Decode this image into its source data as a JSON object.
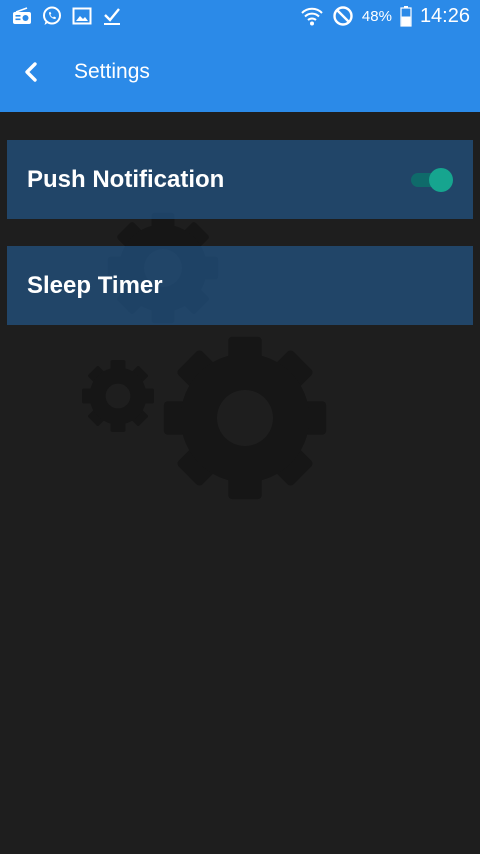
{
  "status_bar": {
    "battery_percent": "48%",
    "time": "14:26",
    "left_icons": [
      "radio-icon",
      "whatsapp-icon",
      "gallery-icon",
      "checkmark-icon"
    ],
    "right_icons": [
      "wifi-icon",
      "do-not-disturb-icon",
      "battery-icon"
    ]
  },
  "app_bar": {
    "title": "Settings",
    "back_icon": "chevron-left-icon",
    "color": "#2b8ae8"
  },
  "settings": {
    "items": [
      {
        "label": "Push Notification",
        "toggle_on": true
      },
      {
        "label": "Sleep Timer"
      }
    ]
  },
  "colors": {
    "background": "#1e1e1e",
    "row": "#245d96",
    "toggle_on": "#16a58f"
  }
}
